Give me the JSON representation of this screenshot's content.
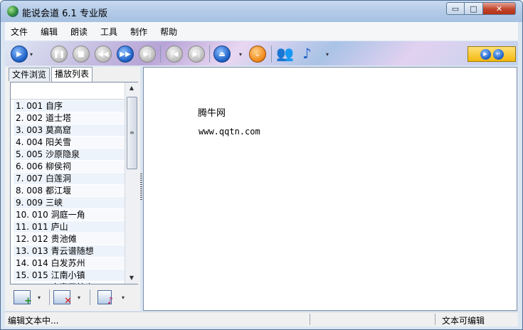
{
  "window": {
    "title": "能说会道 6.1 专业版",
    "minimize_glyph": "▭",
    "maximize_glyph": "□",
    "close_glyph": "✕"
  },
  "menu": [
    "文件",
    "编辑",
    "朗读",
    "工具",
    "制作",
    "帮助"
  ],
  "toolbar": {
    "play_glyph": "▶",
    "pause_glyph": "❚❚",
    "stop_glyph": "■",
    "rewind_glyph": "◀◀",
    "forward_glyph": "▶▶",
    "skip_end_glyph": "▶|",
    "prev_glyph": "|◀",
    "next_glyph": "▶|",
    "eject_glyph": "⏏",
    "down_glyph": "⌄",
    "users_glyph": "👥",
    "note_glyph": "♪",
    "dropdown_glyph": "▾",
    "right_panel": [
      "▶",
      "↩"
    ]
  },
  "left_panel": {
    "tabs": [
      "文件浏览",
      "播放列表"
    ],
    "active_tab": "播放列表",
    "playlist": [
      "1.  001  自序",
      "2.  002  道士塔",
      "3.  003  莫高窟",
      "4.  004  阳关雪",
      "5.  005  沙原隐泉",
      "6.  006  柳侯祠",
      "7.  007  白莲洞",
      "8.  008  都江堰",
      "9.  009  三峡",
      "10.  010  洞庭一角",
      "11.  011  庐山",
      "12.  012  贵池傩",
      "13.  013  青云谱随想",
      "14.  014  白发苏州",
      "15.  015  江南小镇",
      "16.  016  寂寞天柱山"
    ],
    "scroll_up_glyph": "▲",
    "scroll_down_glyph": "▼",
    "scroll_grip_glyph": "≡",
    "tool_add_mark": "+",
    "tool_remove_mark": "✕",
    "tool_list_mark": "♪",
    "tool_dropdown_glyph": "▾"
  },
  "editor": {
    "title": "腾牛网",
    "url": "www.qqtn.com"
  },
  "status": {
    "left": "编辑文本中...",
    "right": "文本可编辑"
  },
  "colors": {
    "accent_blue": "#1f62c8",
    "orange": "#f08a1c",
    "close_red": "#c0452b"
  }
}
